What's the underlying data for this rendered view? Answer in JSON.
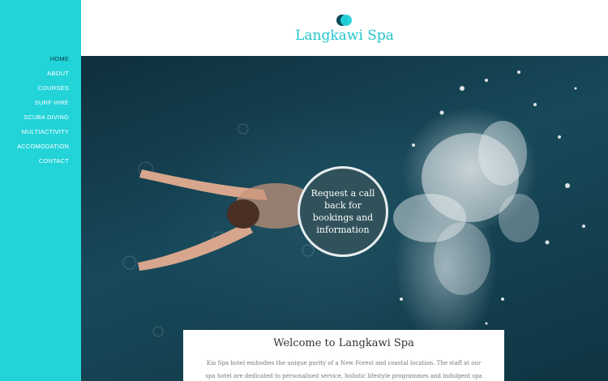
{
  "brand": {
    "title": "Langkawi Spa",
    "accent_color": "#22d3d8",
    "dark_color": "#0e4a57"
  },
  "nav": {
    "items": [
      {
        "label": "HOME",
        "active": true
      },
      {
        "label": "ABOUT"
      },
      {
        "label": "COURSES"
      },
      {
        "label": "SURF HIRE"
      },
      {
        "label": "SCUBA DIVING"
      },
      {
        "label": "MULTIACTIVITY"
      },
      {
        "label": "ACCOMODATION"
      },
      {
        "label": "CONTACT"
      }
    ]
  },
  "hero": {
    "cta_label": "Request a call back for bookings and information",
    "image_icon": "swimmer-photo"
  },
  "welcome": {
    "heading": "Welcome to Langkawi Spa",
    "body": "Kia Spa hotel embodies the unique purity of a New Forest and coastal location. The staff at our spa hotel are dedicated to personalised service, holistic lifestyle programmes and indulgent spa"
  }
}
